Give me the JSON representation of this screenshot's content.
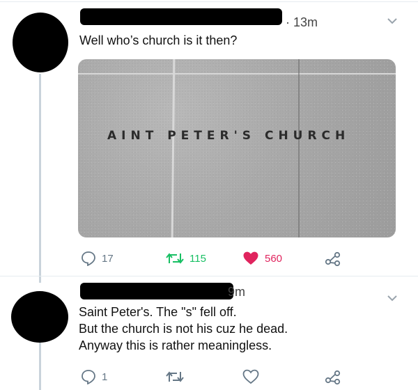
{
  "tweet1": {
    "time": "· 13m",
    "text": "Well who’s church is it then?",
    "image_caption": "AINT PETER'S CHURCH",
    "actions": {
      "replies": "17",
      "retweets": "115",
      "likes": "560"
    },
    "colors": {
      "retweet": "#17bf63",
      "like": "#e0245e"
    }
  },
  "tweet2": {
    "time": "9m",
    "lines": [
      "Saint Peter's. The \"s\" fell off.",
      "But the church is not his cuz he dead.",
      "Anyway this is rather meaningless."
    ],
    "actions": {
      "replies": "1"
    }
  },
  "icons": [
    "reply-icon",
    "retweet-icon",
    "like-icon",
    "share-icon",
    "chevron-down-icon"
  ]
}
